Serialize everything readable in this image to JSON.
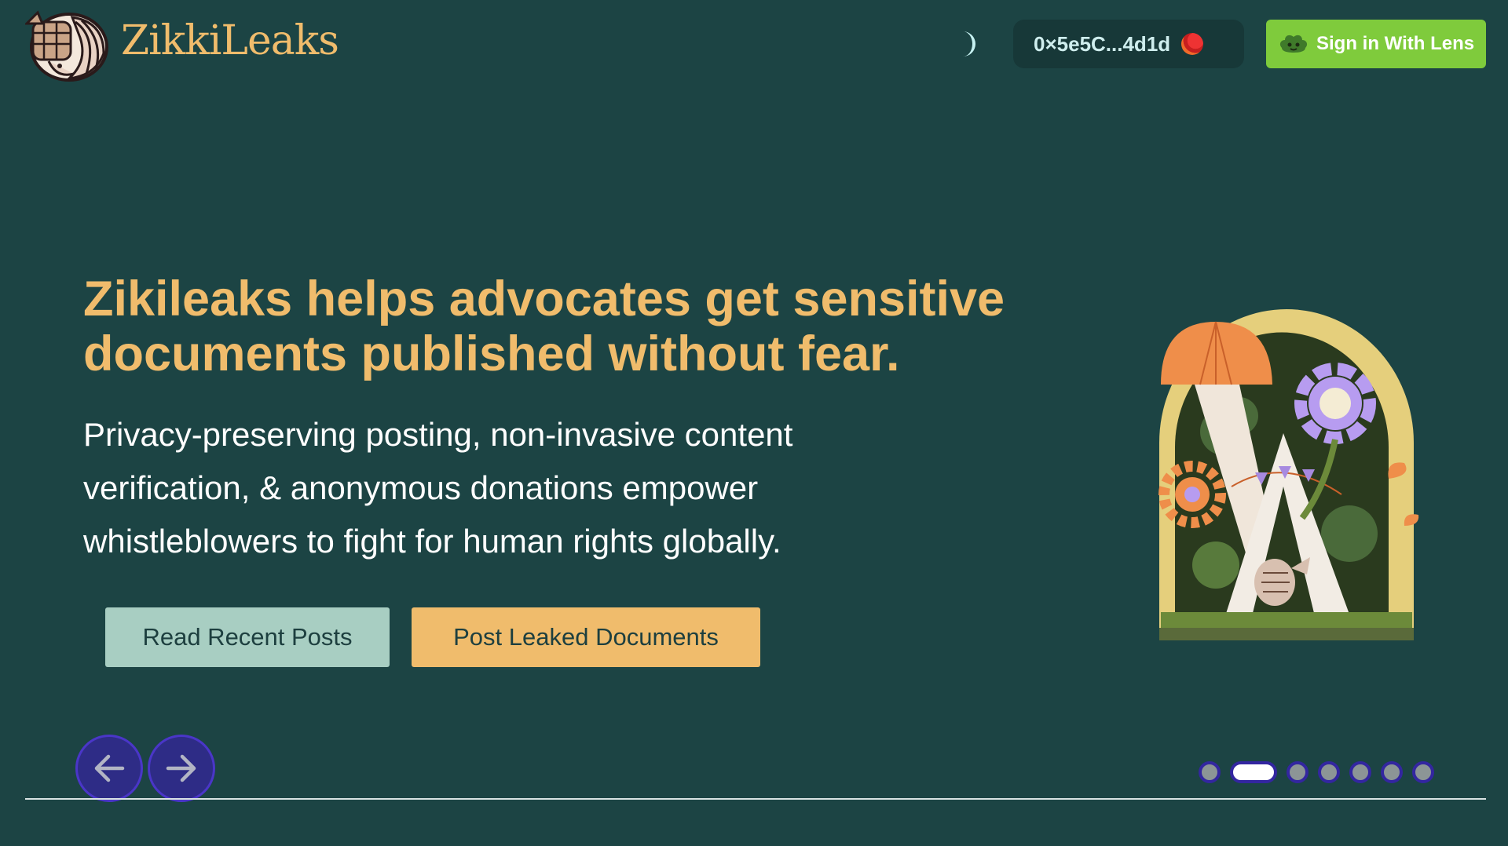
{
  "header": {
    "brand": "ZikkiLeaks",
    "wallet_address": "0×5e5C...4d1d",
    "sign_in_label": "Sign in With Lens"
  },
  "hero": {
    "headline": "Zikileaks helps advocates get sensitive documents published without fear.",
    "subtext": "Privacy-preserving posting, non-invasive content verification, & anonymous donations empower whistleblowers to fight for human rights globally.",
    "read_button": "Read Recent Posts",
    "post_button": "Post Leaked Documents"
  },
  "carousel": {
    "slide_count": 7,
    "active_slide": 2
  },
  "icons": {
    "logo": "armadillo-logo-icon",
    "theme": "moon-icon",
    "lens": "lens-frog-icon",
    "prev": "arrow-left-icon",
    "next": "arrow-right-icon"
  },
  "colors": {
    "background": "#1c4444",
    "accent": "#f0bc6c",
    "lens_green": "#7fcb3c",
    "secondary_button": "#a8cec2",
    "carousel_control": "#2e2c86"
  }
}
